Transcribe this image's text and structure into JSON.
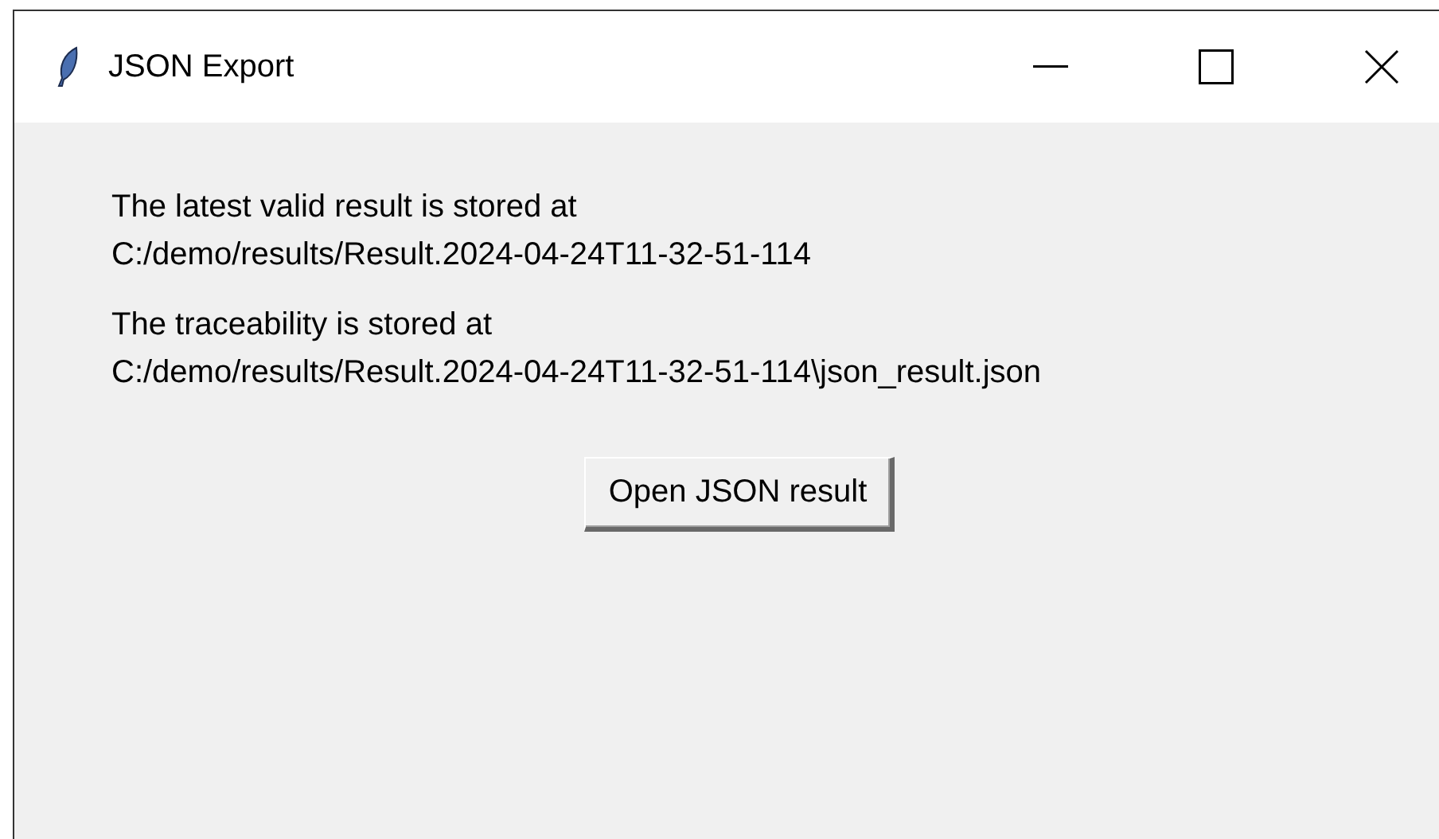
{
  "window": {
    "title": "JSON Export"
  },
  "messages": [
    {
      "lines": [
        "The latest valid result is stored at",
        "C:/demo/results/Result.2024-04-24T11-32-51-114"
      ]
    },
    {
      "lines": [
        "The traceability is stored at",
        "C:/demo/results/Result.2024-04-24T11-32-51-114\\json_result.json"
      ]
    }
  ],
  "button": {
    "label": "Open JSON result"
  }
}
